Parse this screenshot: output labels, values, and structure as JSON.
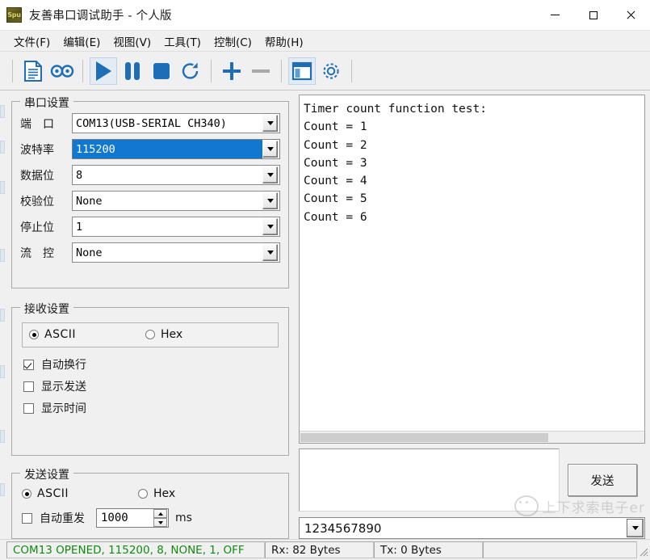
{
  "window": {
    "title": "友善串口调试助手 - 个人版",
    "app_icon_text": "Spu",
    "minimize": "−",
    "maximize": "□",
    "close": "✕"
  },
  "menubar": {
    "items": [
      {
        "label": "文件(F)",
        "name": "menu-file"
      },
      {
        "label": "编辑(E)",
        "name": "menu-edit"
      },
      {
        "label": "视图(V)",
        "name": "menu-view"
      },
      {
        "label": "工具(T)",
        "name": "menu-tools"
      },
      {
        "label": "控制(C)",
        "name": "menu-control"
      },
      {
        "label": "帮助(H)",
        "name": "menu-help"
      }
    ]
  },
  "toolbar": {
    "icons": [
      "document-icon",
      "loop-icon",
      "play-icon",
      "pause-icon",
      "stop-icon",
      "refresh-icon",
      "plus-icon",
      "minus-icon",
      "window-icon",
      "gear-icon"
    ]
  },
  "serial_settings": {
    "legend": "串口设置",
    "fields": [
      {
        "label": "端　口",
        "value": "COM13(USB-SERIAL CH340)",
        "selected": false
      },
      {
        "label": "波特率",
        "value": "115200",
        "selected": true
      },
      {
        "label": "数据位",
        "value": "8",
        "selected": false
      },
      {
        "label": "校验位",
        "value": "None",
        "selected": false
      },
      {
        "label": "停止位",
        "value": "1",
        "selected": false
      },
      {
        "label": "流　控",
        "value": "None",
        "selected": false
      }
    ]
  },
  "receive_settings": {
    "legend": "接收设置",
    "format": {
      "ascii": "ASCII",
      "hex": "Hex",
      "selected": "ASCII"
    },
    "checkboxes": [
      {
        "label": "自动换行",
        "checked": true
      },
      {
        "label": "显示发送",
        "checked": false
      },
      {
        "label": "显示时间",
        "checked": false
      }
    ]
  },
  "send_settings": {
    "legend": "发送设置",
    "format": {
      "ascii": "ASCII",
      "hex": "Hex",
      "selected": "ASCII"
    },
    "auto_resend": {
      "label": "自动重发",
      "checked": false,
      "interval": "1000",
      "unit": "ms"
    }
  },
  "receive_area": {
    "text": "Timer count function test:\nCount = 1\nCount = 2\nCount = 3\nCount = 4\nCount = 5\nCount = 6"
  },
  "send_area": {
    "input_value": "",
    "send_button": "发送",
    "history_value": "1234567890"
  },
  "watermark": {
    "text": "上下求索电子er",
    "icon": "wechat-icon"
  },
  "statusbar": {
    "port_status": "COM13 OPENED, 115200, 8, NONE, 1, OFF",
    "rx": "Rx: 82 Bytes",
    "tx": "Tx: 0 Bytes",
    "extra": ""
  },
  "colors": {
    "accent_blue": "#1f6eb5",
    "selection_blue": "#1078d0",
    "status_green": "#118a11",
    "chrome": "#f0f0f0"
  }
}
